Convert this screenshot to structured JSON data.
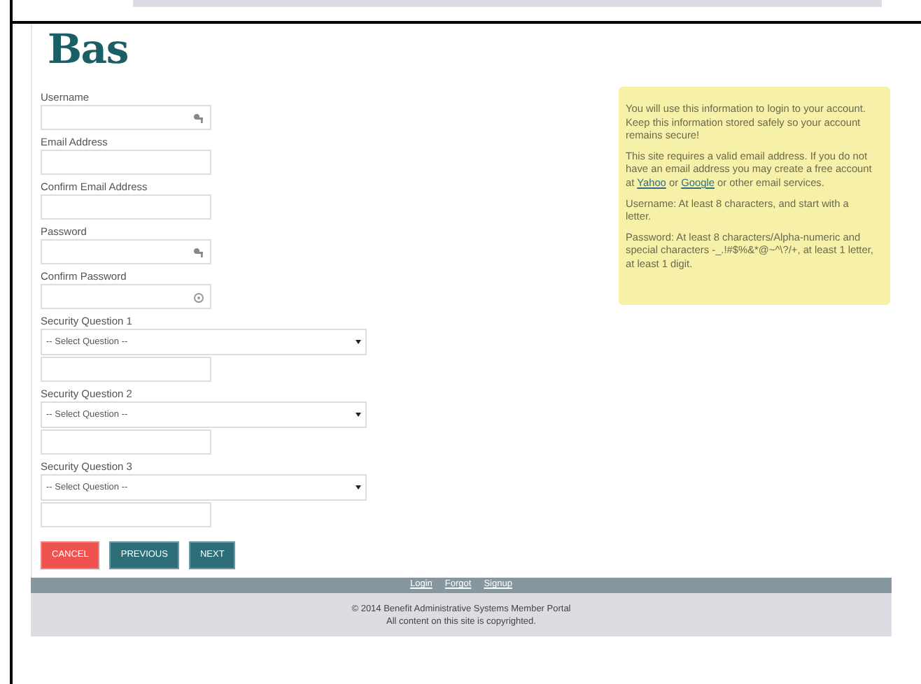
{
  "logo": "Bas",
  "fields": [
    {
      "label": "Username",
      "kind": "autofill"
    },
    {
      "label": "Email Address",
      "kind": "plain"
    },
    {
      "label": "Confirm Email Address",
      "kind": "plain"
    },
    {
      "label": "Password",
      "kind": "autofill"
    },
    {
      "label": "Confirm Password",
      "kind": "reveal"
    }
  ],
  "security_questions": [
    {
      "label": "Security Question 1",
      "value": "-- Select Question --"
    },
    {
      "label": "Security Question 2",
      "value": "-- Select Question --"
    },
    {
      "label": "Security Question 3",
      "value": "-- Select Question --"
    }
  ],
  "buttons": [
    {
      "label": "CANCEL",
      "kind": "danger"
    },
    {
      "label": "PREVIOUS",
      "kind": "primary"
    },
    {
      "label": "NEXT",
      "kind": "primary"
    }
  ],
  "info": {
    "paragraph_1": "You will use this information to login to your account.  Keep this information stored safely so your account remains secure!",
    "paragraph_2": {
      "before": "This site requires a valid email address. If you do not have an email address you may create a free account at",
      "link_1": "Yahoo",
      "middle": "or",
      "link_2": "Google",
      "after": "or other email services."
    },
    "paragraph_3": "Username: At least 8 characters, and start with a letter.",
    "paragraph_4": "Password: At least 8 characters/Alpha-numeric and special characters -_.!#$%&*@~^\\?/+, at least 1 letter, at least 1 digit."
  },
  "footer": {
    "links": [
      "Login",
      "Forgot",
      "Signup"
    ],
    "copyright": "© 2014 Benefit Administrative Systems Member Portal",
    "notice": "All content on this site is copyrighted."
  }
}
